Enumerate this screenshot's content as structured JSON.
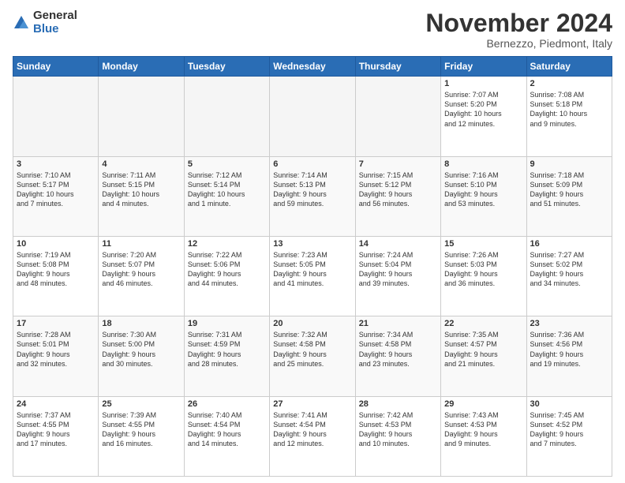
{
  "logo": {
    "general": "General",
    "blue": "Blue"
  },
  "title": {
    "month": "November 2024",
    "location": "Bernezzo, Piedmont, Italy"
  },
  "weekdays": [
    "Sunday",
    "Monday",
    "Tuesday",
    "Wednesday",
    "Thursday",
    "Friday",
    "Saturday"
  ],
  "weeks": [
    [
      {
        "day": "",
        "info": ""
      },
      {
        "day": "",
        "info": ""
      },
      {
        "day": "",
        "info": ""
      },
      {
        "day": "",
        "info": ""
      },
      {
        "day": "",
        "info": ""
      },
      {
        "day": "1",
        "info": "Sunrise: 7:07 AM\nSunset: 5:20 PM\nDaylight: 10 hours\nand 12 minutes."
      },
      {
        "day": "2",
        "info": "Sunrise: 7:08 AM\nSunset: 5:18 PM\nDaylight: 10 hours\nand 9 minutes."
      }
    ],
    [
      {
        "day": "3",
        "info": "Sunrise: 7:10 AM\nSunset: 5:17 PM\nDaylight: 10 hours\nand 7 minutes."
      },
      {
        "day": "4",
        "info": "Sunrise: 7:11 AM\nSunset: 5:15 PM\nDaylight: 10 hours\nand 4 minutes."
      },
      {
        "day": "5",
        "info": "Sunrise: 7:12 AM\nSunset: 5:14 PM\nDaylight: 10 hours\nand 1 minute."
      },
      {
        "day": "6",
        "info": "Sunrise: 7:14 AM\nSunset: 5:13 PM\nDaylight: 9 hours\nand 59 minutes."
      },
      {
        "day": "7",
        "info": "Sunrise: 7:15 AM\nSunset: 5:12 PM\nDaylight: 9 hours\nand 56 minutes."
      },
      {
        "day": "8",
        "info": "Sunrise: 7:16 AM\nSunset: 5:10 PM\nDaylight: 9 hours\nand 53 minutes."
      },
      {
        "day": "9",
        "info": "Sunrise: 7:18 AM\nSunset: 5:09 PM\nDaylight: 9 hours\nand 51 minutes."
      }
    ],
    [
      {
        "day": "10",
        "info": "Sunrise: 7:19 AM\nSunset: 5:08 PM\nDaylight: 9 hours\nand 48 minutes."
      },
      {
        "day": "11",
        "info": "Sunrise: 7:20 AM\nSunset: 5:07 PM\nDaylight: 9 hours\nand 46 minutes."
      },
      {
        "day": "12",
        "info": "Sunrise: 7:22 AM\nSunset: 5:06 PM\nDaylight: 9 hours\nand 44 minutes."
      },
      {
        "day": "13",
        "info": "Sunrise: 7:23 AM\nSunset: 5:05 PM\nDaylight: 9 hours\nand 41 minutes."
      },
      {
        "day": "14",
        "info": "Sunrise: 7:24 AM\nSunset: 5:04 PM\nDaylight: 9 hours\nand 39 minutes."
      },
      {
        "day": "15",
        "info": "Sunrise: 7:26 AM\nSunset: 5:03 PM\nDaylight: 9 hours\nand 36 minutes."
      },
      {
        "day": "16",
        "info": "Sunrise: 7:27 AM\nSunset: 5:02 PM\nDaylight: 9 hours\nand 34 minutes."
      }
    ],
    [
      {
        "day": "17",
        "info": "Sunrise: 7:28 AM\nSunset: 5:01 PM\nDaylight: 9 hours\nand 32 minutes."
      },
      {
        "day": "18",
        "info": "Sunrise: 7:30 AM\nSunset: 5:00 PM\nDaylight: 9 hours\nand 30 minutes."
      },
      {
        "day": "19",
        "info": "Sunrise: 7:31 AM\nSunset: 4:59 PM\nDaylight: 9 hours\nand 28 minutes."
      },
      {
        "day": "20",
        "info": "Sunrise: 7:32 AM\nSunset: 4:58 PM\nDaylight: 9 hours\nand 25 minutes."
      },
      {
        "day": "21",
        "info": "Sunrise: 7:34 AM\nSunset: 4:58 PM\nDaylight: 9 hours\nand 23 minutes."
      },
      {
        "day": "22",
        "info": "Sunrise: 7:35 AM\nSunset: 4:57 PM\nDaylight: 9 hours\nand 21 minutes."
      },
      {
        "day": "23",
        "info": "Sunrise: 7:36 AM\nSunset: 4:56 PM\nDaylight: 9 hours\nand 19 minutes."
      }
    ],
    [
      {
        "day": "24",
        "info": "Sunrise: 7:37 AM\nSunset: 4:55 PM\nDaylight: 9 hours\nand 17 minutes."
      },
      {
        "day": "25",
        "info": "Sunrise: 7:39 AM\nSunset: 4:55 PM\nDaylight: 9 hours\nand 16 minutes."
      },
      {
        "day": "26",
        "info": "Sunrise: 7:40 AM\nSunset: 4:54 PM\nDaylight: 9 hours\nand 14 minutes."
      },
      {
        "day": "27",
        "info": "Sunrise: 7:41 AM\nSunset: 4:54 PM\nDaylight: 9 hours\nand 12 minutes."
      },
      {
        "day": "28",
        "info": "Sunrise: 7:42 AM\nSunset: 4:53 PM\nDaylight: 9 hours\nand 10 minutes."
      },
      {
        "day": "29",
        "info": "Sunrise: 7:43 AM\nSunset: 4:53 PM\nDaylight: 9 hours\nand 9 minutes."
      },
      {
        "day": "30",
        "info": "Sunrise: 7:45 AM\nSunset: 4:52 PM\nDaylight: 9 hours\nand 7 minutes."
      }
    ]
  ]
}
